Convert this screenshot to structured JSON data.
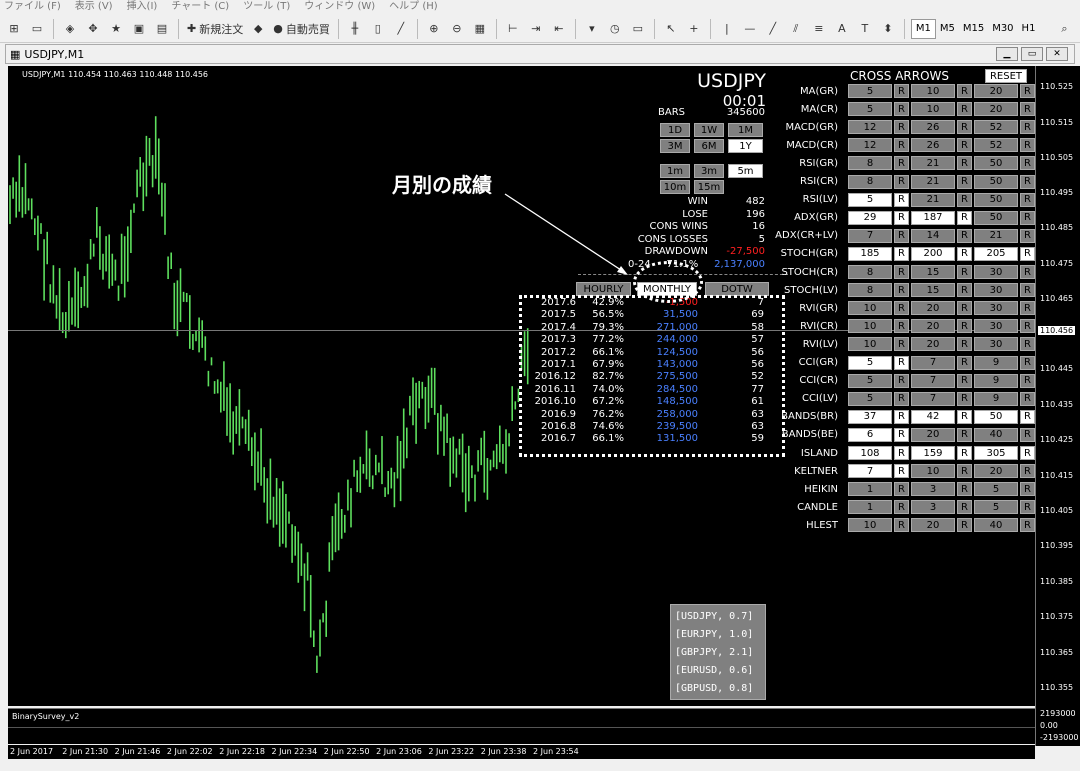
{
  "menu": [
    "ファイル (F)",
    "表示 (V)",
    "挿入(I)",
    "チャート (C)",
    "ツール (T)",
    "ウィンドウ (W)",
    "ヘルプ (H)"
  ],
  "toolbar": {
    "new_order": "新規注文",
    "auto_trade": "自動売買",
    "timeframes": [
      "M1",
      "M5",
      "M15",
      "M30",
      "H1"
    ],
    "selected_tf": "M1"
  },
  "window": {
    "title": "USDJPY,M1"
  },
  "chart": {
    "header": "USDJPY,M1  110.454 110.463 110.448 110.456",
    "symbol": "USDJPY",
    "time": "00:01",
    "bars_label": "BARS",
    "bars_value": "345600",
    "periods": [
      "1D",
      "1W",
      "1M",
      "3M",
      "6M",
      "1Y"
    ],
    "intervals": [
      "1m",
      "3m",
      "5m",
      "10m",
      "15m"
    ],
    "stats": [
      {
        "k": "WIN",
        "v": "482"
      },
      {
        "k": "LOSE",
        "v": "196"
      },
      {
        "k": "CONS WINS",
        "v": "16"
      },
      {
        "k": "CONS LOSSES",
        "v": "5"
      },
      {
        "k": "DRAWDOWN",
        "v": "-27,500"
      }
    ],
    "summary": {
      "range": "0-24",
      "pct": "71.1%",
      "amount": "2,137,000"
    },
    "tabs": [
      "HOURLY",
      "MONTHLY",
      "DOTW"
    ],
    "annotation": "月別の成績",
    "monthly": [
      {
        "m": "2017.6",
        "p": "42.9%",
        "a": "-1,500",
        "n": "7"
      },
      {
        "m": "2017.5",
        "p": "56.5%",
        "a": "31,500",
        "n": "69"
      },
      {
        "m": "2017.4",
        "p": "79.3%",
        "a": "271,000",
        "n": "58"
      },
      {
        "m": "2017.3",
        "p": "77.2%",
        "a": "244,000",
        "n": "57"
      },
      {
        "m": "2017.2",
        "p": "66.1%",
        "a": "124,500",
        "n": "56"
      },
      {
        "m": "2017.1",
        "p": "67.9%",
        "a": "143,000",
        "n": "56"
      },
      {
        "m": "2016.12",
        "p": "82.7%",
        "a": "275,500",
        "n": "52"
      },
      {
        "m": "2016.11",
        "p": "74.0%",
        "a": "284,500",
        "n": "77"
      },
      {
        "m": "2016.10",
        "p": "67.2%",
        "a": "148,500",
        "n": "61"
      },
      {
        "m": "2016.9",
        "p": "76.2%",
        "a": "258,000",
        "n": "63"
      },
      {
        "m": "2016.8",
        "p": "74.6%",
        "a": "239,500",
        "n": "63"
      },
      {
        "m": "2016.7",
        "p": "66.1%",
        "a": "131,500",
        "n": "59"
      }
    ],
    "pairs": [
      "[USDJPY, 0.7]",
      "[EURJPY, 1.0]",
      "[GBPJPY, 2.1]",
      "[EURUSD, 0.6]",
      "[GBPUSD, 0.8]"
    ]
  },
  "cross": {
    "title": "CROSS ARROWS",
    "reset": "RESET",
    "r": "R",
    "rows": [
      {
        "name": "MA(GR)",
        "v": [
          "5",
          "10",
          "20"
        ],
        "w": [
          0,
          0,
          0
        ]
      },
      {
        "name": "MA(CR)",
        "v": [
          "5",
          "10",
          "20"
        ],
        "w": [
          0,
          0,
          0
        ]
      },
      {
        "name": "MACD(GR)",
        "v": [
          "12",
          "26",
          "52"
        ],
        "w": [
          0,
          0,
          0
        ]
      },
      {
        "name": "MACD(CR)",
        "v": [
          "12",
          "26",
          "52"
        ],
        "w": [
          0,
          0,
          0
        ]
      },
      {
        "name": "RSI(GR)",
        "v": [
          "8",
          "21",
          "50"
        ],
        "w": [
          0,
          0,
          0
        ]
      },
      {
        "name": "RSI(CR)",
        "v": [
          "8",
          "21",
          "50"
        ],
        "w": [
          0,
          0,
          0
        ]
      },
      {
        "name": "RSI(LV)",
        "v": [
          "5",
          "21",
          "50"
        ],
        "w": [
          1,
          0,
          0
        ]
      },
      {
        "name": "ADX(GR)",
        "v": [
          "29",
          "187",
          "50"
        ],
        "w": [
          1,
          1,
          0
        ]
      },
      {
        "name": "ADX(CR+LV)",
        "v": [
          "7",
          "14",
          "21"
        ],
        "w": [
          0,
          0,
          0
        ]
      },
      {
        "name": "STOCH(GR)",
        "v": [
          "185",
          "200",
          "205"
        ],
        "w": [
          1,
          1,
          1
        ]
      },
      {
        "name": "STOCH(CR)",
        "v": [
          "8",
          "15",
          "30"
        ],
        "w": [
          0,
          0,
          0
        ]
      },
      {
        "name": "STOCH(LV)",
        "v": [
          "8",
          "15",
          "30"
        ],
        "w": [
          0,
          0,
          0
        ]
      },
      {
        "name": "RVI(GR)",
        "v": [
          "10",
          "20",
          "30"
        ],
        "w": [
          0,
          0,
          0
        ]
      },
      {
        "name": "RVI(CR)",
        "v": [
          "10",
          "20",
          "30"
        ],
        "w": [
          0,
          0,
          0
        ]
      },
      {
        "name": "RVI(LV)",
        "v": [
          "10",
          "20",
          "30"
        ],
        "w": [
          0,
          0,
          0
        ]
      },
      {
        "name": "CCI(GR)",
        "v": [
          "5",
          "7",
          "9"
        ],
        "w": [
          1,
          0,
          0
        ]
      },
      {
        "name": "CCI(CR)",
        "v": [
          "5",
          "7",
          "9"
        ],
        "w": [
          0,
          0,
          0
        ]
      },
      {
        "name": "CCI(LV)",
        "v": [
          "5",
          "7",
          "9"
        ],
        "w": [
          0,
          0,
          0
        ]
      },
      {
        "name": "BANDS(BR)",
        "v": [
          "37",
          "42",
          "50"
        ],
        "w": [
          1,
          1,
          1
        ]
      },
      {
        "name": "BANDS(BE)",
        "v": [
          "6",
          "20",
          "40"
        ],
        "w": [
          1,
          0,
          0
        ]
      },
      {
        "name": "ISLAND",
        "v": [
          "108",
          "159",
          "305"
        ],
        "w": [
          1,
          1,
          1
        ]
      },
      {
        "name": "KELTNER",
        "v": [
          "7",
          "10",
          "20"
        ],
        "w": [
          1,
          0,
          0
        ]
      },
      {
        "name": "HEIKIN",
        "v": [
          "1",
          "3",
          "5"
        ],
        "w": [
          0,
          0,
          0
        ]
      },
      {
        "name": "CANDLE",
        "v": [
          "1",
          "3",
          "5"
        ],
        "w": [
          0,
          0,
          0
        ]
      },
      {
        "name": "HLEST",
        "v": [
          "10",
          "20",
          "40"
        ],
        "w": [
          0,
          0,
          0
        ]
      }
    ]
  },
  "yaxis": [
    "110.525",
    "110.515",
    "110.505",
    "110.495",
    "110.485",
    "110.475",
    "110.465",
    "110.456",
    "110.445",
    "110.435",
    "110.425",
    "110.415",
    "110.405",
    "110.395",
    "110.385",
    "110.375",
    "110.365",
    "110.355"
  ],
  "sub_yaxis": [
    "2193000",
    "0.00",
    "-2193000"
  ],
  "xaxis": [
    "2 Jun 2017",
    "2 Jun 21:30",
    "2 Jun 21:46",
    "2 Jun 22:02",
    "2 Jun 22:18",
    "2 Jun 22:34",
    "2 Jun 22:50",
    "2 Jun 23:06",
    "2 Jun 23:22",
    "2 Jun 23:38",
    "2 Jun 23:54"
  ],
  "indicator": "BinarySurvey_v2"
}
